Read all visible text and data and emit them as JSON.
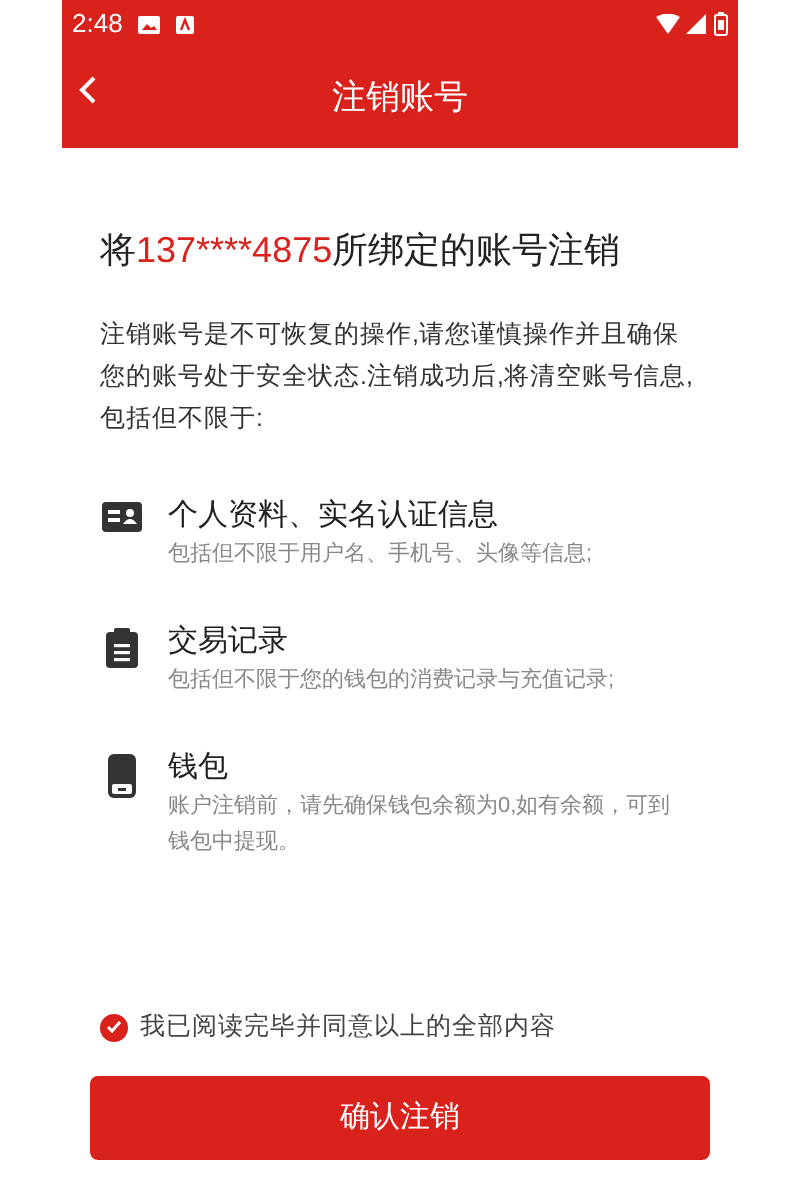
{
  "status_bar": {
    "time": "2:48"
  },
  "header": {
    "title": "注销账号"
  },
  "heading": {
    "prefix": "将",
    "phone": "137****4875",
    "suffix": "所绑定的账号注销"
  },
  "intro": "注销账号是不可恢复的操作,请您谨慎操作并且确保您的账号处于安全状态.注销成功后,将清空账号信息,包括但不限于:",
  "items": [
    {
      "kind": "profile",
      "title": "个人资料、实名认证信息",
      "description": "包括但不限于用户名、手机号、头像等信息;"
    },
    {
      "kind": "records",
      "title": "交易记录",
      "description": "包括但不限于您的钱包的消费记录与充值记录;"
    },
    {
      "kind": "wallet",
      "title": "钱包",
      "description": "账户注销前，请先确保钱包余额为0,如有余额，可到钱包中提现。"
    }
  ],
  "agreement": {
    "checked": true,
    "label": "我已阅读完毕并同意以上的全部内容"
  },
  "confirm_button": "确认注销"
}
